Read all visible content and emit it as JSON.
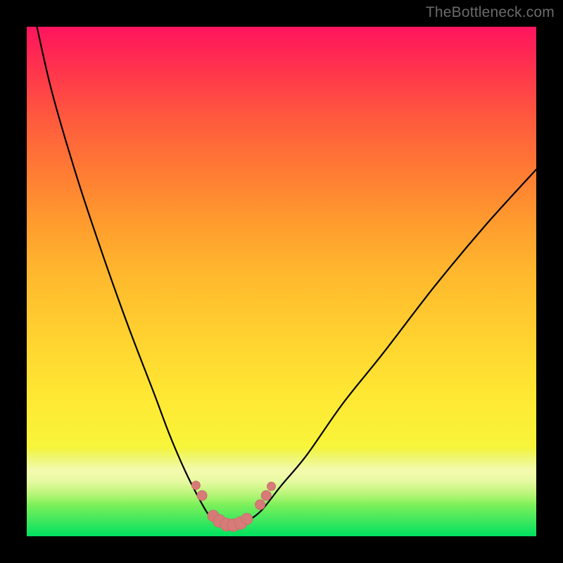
{
  "watermark": "TheBottleneck.com",
  "colors": {
    "curve_stroke": "#000000",
    "marker_fill": "#d77b78",
    "marker_stroke": "#c86f6c",
    "frame_bg": "#000000"
  },
  "chart_data": {
    "type": "line",
    "title": "",
    "xlabel": "",
    "ylabel": "",
    "xlim": [
      0,
      100
    ],
    "ylim": [
      0,
      100
    ],
    "series": [
      {
        "name": "left-branch",
        "x": [
          2,
          5,
          10,
          15,
          20,
          25,
          28,
          31,
          33.5,
          35.5,
          37
        ],
        "y": [
          100,
          87,
          70,
          55,
          41,
          28,
          20,
          13,
          8,
          4.5,
          2.8
        ]
      },
      {
        "name": "trough",
        "x": [
          37,
          38.5,
          40,
          41.5,
          43
        ],
        "y": [
          2.8,
          2.2,
          2.0,
          2.2,
          2.8
        ]
      },
      {
        "name": "right-branch",
        "x": [
          43,
          46,
          50,
          55,
          62,
          70,
          80,
          90,
          100
        ],
        "y": [
          2.8,
          5,
          10,
          16,
          26,
          36,
          49,
          61,
          72
        ]
      }
    ],
    "markers": {
      "name": "bottom-dots",
      "points": [
        {
          "x": 33.2,
          "y": 10.0,
          "r": 6
        },
        {
          "x": 34.4,
          "y": 8.0,
          "r": 7
        },
        {
          "x": 36.6,
          "y": 4.0,
          "r": 8
        },
        {
          "x": 37.8,
          "y": 3.0,
          "r": 9
        },
        {
          "x": 39.2,
          "y": 2.3,
          "r": 9
        },
        {
          "x": 40.6,
          "y": 2.2,
          "r": 9
        },
        {
          "x": 42.0,
          "y": 2.6,
          "r": 9
        },
        {
          "x": 43.2,
          "y": 3.4,
          "r": 8
        },
        {
          "x": 45.8,
          "y": 6.2,
          "r": 7
        },
        {
          "x": 47.0,
          "y": 8.0,
          "r": 7
        },
        {
          "x": 48.0,
          "y": 9.8,
          "r": 6
        }
      ]
    }
  }
}
